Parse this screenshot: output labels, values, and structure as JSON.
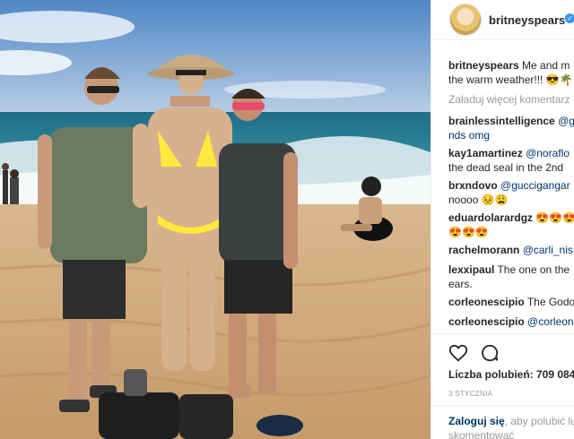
{
  "post": {
    "image_alt": "beach photo of woman in yellow bikini with two boys",
    "username": "britneyspears",
    "verified_icon": "verified-icon",
    "caption": {
      "user": "britneyspears",
      "text_line1": " Me and m",
      "text_line2": "the warm weather!!! 😎🌴"
    },
    "load_more": "Załaduj więcej komentarz",
    "comments": [
      {
        "user": "brainlessintelligence",
        "text_start": " ",
        "mention": "@g",
        "line2": "nds omg"
      },
      {
        "user": "kay1amartinez",
        "text_start": " ",
        "mention": "@noraflo",
        "line2": "the dead seal in the 2nd"
      },
      {
        "user": "brxndovo",
        "text_start": " ",
        "mention": "@guccigangar",
        "line2": "noooo 😣😩"
      },
      {
        "user": "eduardolarardgz",
        "text_start": " ",
        "emoji_line1": "😍😍😍",
        "line2": "😍😍😍"
      },
      {
        "user": "rachelmorann",
        "text_start": " ",
        "mention": "@carli_nis"
      },
      {
        "user": "lexxipaul",
        "text_start": " The one on the",
        "line2": "ears."
      },
      {
        "user": "corleonescipio",
        "text_start": " The Godo"
      },
      {
        "user": "corleonescipio",
        "text_start": " ",
        "mention": "@corleon"
      }
    ],
    "likes": "Liczba polubień: 709 084",
    "date": "3 STYCZNIA",
    "login": {
      "link": "Zaloguj się",
      "rest": ", aby polubić lu",
      "line2": "skomentować"
    },
    "icons": {
      "like": "heart-icon",
      "comment": "comment-bubble-icon"
    }
  }
}
